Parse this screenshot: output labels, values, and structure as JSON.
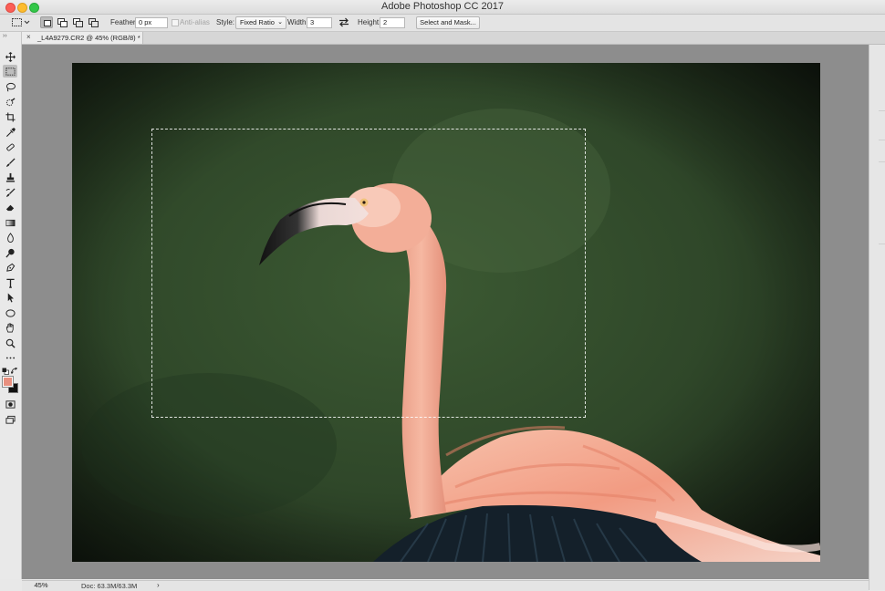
{
  "window": {
    "title": "Adobe Photoshop CC 2017"
  },
  "options_bar": {
    "feather_label": "Feather:",
    "feather_value": "0 px",
    "anti_alias_label": "Anti-alias",
    "style_label": "Style:",
    "style_value": "Fixed Ratio",
    "width_label": "Width:",
    "width_value": "3",
    "swap_icon": "swap-arrows-icon",
    "height_label": "Height:",
    "height_value": "2",
    "select_mask_label": "Select and Mask..."
  },
  "document_tab": {
    "close_glyph": "×",
    "name": "_L4A9279.CR2 @ 45% (RGB/8) *"
  },
  "toolbar": {
    "collapse_glyph": "››",
    "tools": [
      "move-tool-icon",
      "rectangular-marquee-tool-icon",
      "lasso-tool-icon",
      "quick-selection-tool-icon",
      "crop-tool-icon",
      "eyedropper-tool-icon",
      "spot-healing-brush-icon",
      "brush-tool-icon",
      "clone-stamp-icon",
      "history-brush-icon",
      "eraser-tool-icon",
      "gradient-tool-icon",
      "blur-tool-icon",
      "dodge-tool-icon",
      "pen-tool-icon",
      "type-tool-icon",
      "path-selection-tool-icon",
      "ellipse-tool-icon",
      "hand-tool-icon",
      "zoom-tool-icon",
      "more-tools-icon"
    ],
    "foreground_color": "#e8907f",
    "background_color": "#111111"
  },
  "status_bar": {
    "zoom": "45%",
    "doc_info": "Doc: 63.3M/63.3M",
    "arrow": "›"
  },
  "colors": {
    "canvas_bg": "#8d8d8d",
    "photo_bg": "#2f4528",
    "flamingo": "#f2a592"
  }
}
